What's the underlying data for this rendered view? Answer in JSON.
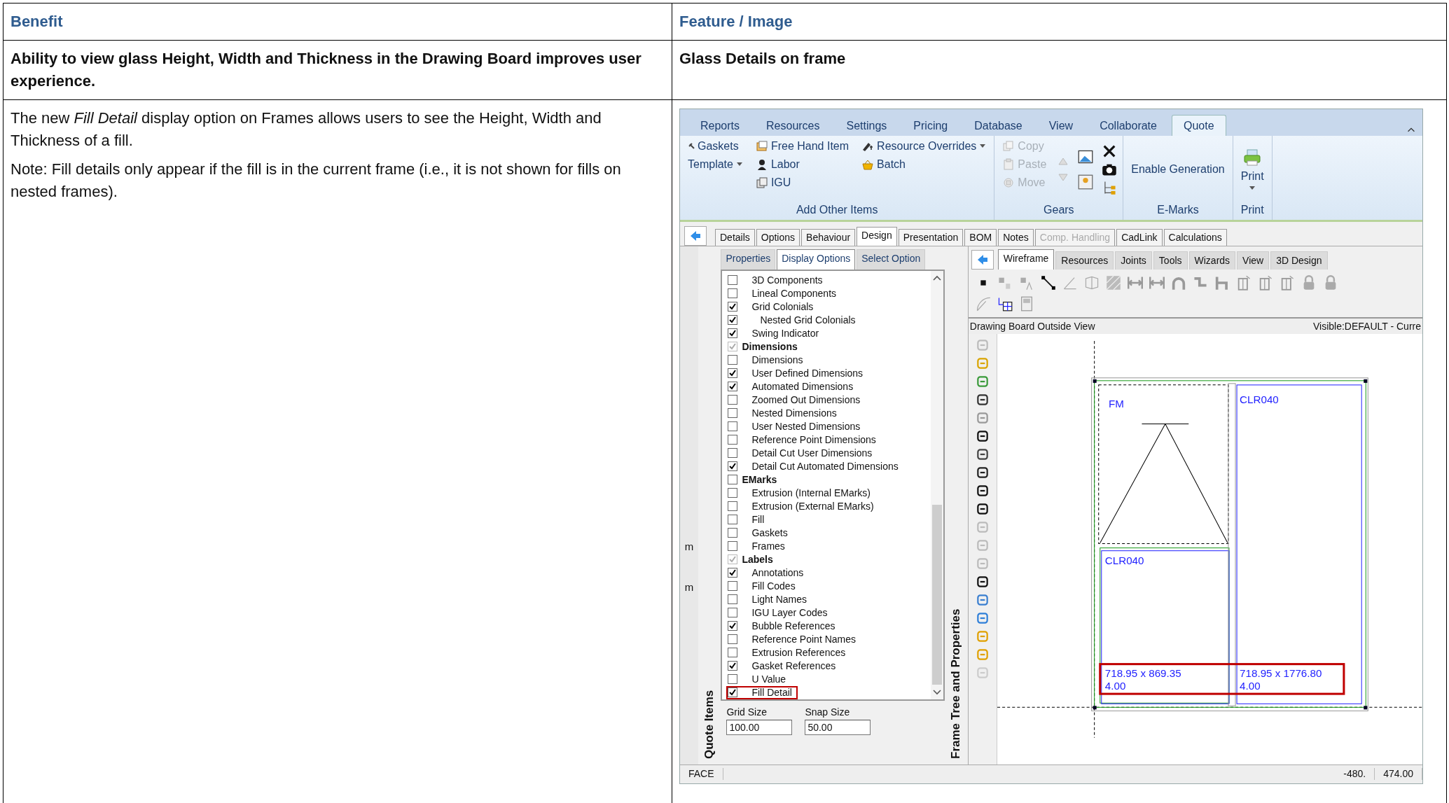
{
  "table": {
    "headers": [
      "Benefit",
      "Feature / Image"
    ],
    "summary": [
      "Ability to view glass Height, Width and Thickness in the Drawing Board improves user experience.",
      "Glass Details on frame"
    ],
    "description": [
      "The new *Fill Detail* display option on Frames allows users to see the Height, Width and Thickness of a fill.",
      "Note: Fill details only appear if the fill is in the current frame (i.e., it is not shown for fills on nested frames)."
    ],
    "screenshot": {
      "ribbon_tabs": [
        {
          "label": "Reports",
          "selected": false
        },
        {
          "label": "Resources",
          "selected": false
        },
        {
          "label": "Settings",
          "selected": false
        },
        {
          "label": "Pricing",
          "selected": false
        },
        {
          "label": "Database",
          "selected": false
        },
        {
          "label": "View",
          "selected": false
        },
        {
          "label": "Collaborate",
          "selected": false
        },
        {
          "label": "Quote",
          "selected": true
        }
      ],
      "ribbon_groups": [
        {
          "label": "Add Other Items",
          "columns": [
            [
              {
                "label": "Gaskets",
                "dropdown": false
              },
              {
                "label": "Template",
                "dropdown": true
              }
            ],
            [
              {
                "label": "Free Hand Item",
                "dropdown": false
              },
              {
                "label": "Labor",
                "dropdown": false
              },
              {
                "label": "IGU",
                "dropdown": false
              }
            ],
            [
              {
                "label": "Resource Overrides",
                "dropdown": true
              },
              {
                "label": "Batch",
                "dropdown": false
              }
            ]
          ]
        },
        {
          "label": "Gears",
          "columns": [
            [
              {
                "label": "Copy",
                "disabled": true
              },
              {
                "label": "Paste",
                "disabled": true
              },
              {
                "label": "Move",
                "disabled": true
              }
            ]
          ]
        },
        {
          "label": "E-Marks",
          "columns": [
            [
              {
                "label": "Enable Generation",
                "disabled": false
              }
            ]
          ]
        },
        {
          "label": "Print",
          "columns": [
            [
              {
                "label": "Print",
                "dropdown": true
              }
            ]
          ]
        }
      ],
      "doc_tabs": [
        {
          "label": "Details",
          "selected": false,
          "disabled": false
        },
        {
          "label": "Options",
          "selected": false,
          "disabled": false
        },
        {
          "label": "Behaviour",
          "selected": false,
          "disabled": false
        },
        {
          "label": "Design",
          "selected": true,
          "disabled": false
        },
        {
          "label": "Presentation",
          "selected": false,
          "disabled": false
        },
        {
          "label": "BOM",
          "selected": false,
          "disabled": false
        },
        {
          "label": "Notes",
          "selected": false,
          "disabled": false
        },
        {
          "label": "Comp. Handling",
          "selected": false,
          "disabled": true
        },
        {
          "label": "CadLink",
          "selected": false,
          "disabled": false
        },
        {
          "label": "Calculations",
          "selected": false,
          "disabled": false
        }
      ],
      "side_labels": [
        "m",
        "m"
      ],
      "left_title": "Quote Items",
      "panel_tabs": [
        {
          "label": "Properties",
          "selected": false
        },
        {
          "label": "Display Options",
          "selected": true
        },
        {
          "label": "Select Option",
          "selected": false
        }
      ],
      "options": [
        {
          "label": "3D Components",
          "kind": "item",
          "checked": false,
          "disabled": false,
          "highlighted": false
        },
        {
          "label": "Lineal Components",
          "kind": "item",
          "checked": false,
          "disabled": false,
          "highlighted": false
        },
        {
          "label": "Grid Colonials",
          "kind": "item",
          "checked": true,
          "disabled": false,
          "highlighted": false
        },
        {
          "label": "Nested Grid Colonials",
          "kind": "subitem",
          "checked": true,
          "disabled": false,
          "highlighted": false
        },
        {
          "label": "Swing Indicator",
          "kind": "item",
          "checked": true,
          "disabled": false,
          "highlighted": false
        },
        {
          "label": "Dimensions",
          "kind": "heading",
          "checked": true,
          "disabled": true,
          "highlighted": false
        },
        {
          "label": "Dimensions",
          "kind": "item",
          "checked": false,
          "disabled": false,
          "highlighted": false
        },
        {
          "label": "User Defined Dimensions",
          "kind": "item",
          "checked": true,
          "disabled": false,
          "highlighted": false
        },
        {
          "label": "Automated Dimensions",
          "kind": "item",
          "checked": true,
          "disabled": false,
          "highlighted": false
        },
        {
          "label": "Zoomed Out Dimensions",
          "kind": "item",
          "checked": false,
          "disabled": false,
          "highlighted": false
        },
        {
          "label": "Nested Dimensions",
          "kind": "item",
          "checked": false,
          "disabled": false,
          "highlighted": false
        },
        {
          "label": "User Nested Dimensions",
          "kind": "item",
          "checked": false,
          "disabled": false,
          "highlighted": false
        },
        {
          "label": "Reference Point Dimensions",
          "kind": "item",
          "checked": false,
          "disabled": false,
          "highlighted": false
        },
        {
          "label": "Detail Cut User Dimensions",
          "kind": "item",
          "checked": false,
          "disabled": false,
          "highlighted": false
        },
        {
          "label": "Detail Cut Automated Dimensions",
          "kind": "item",
          "checked": true,
          "disabled": false,
          "highlighted": false
        },
        {
          "label": "EMarks",
          "kind": "heading",
          "checked": false,
          "disabled": false,
          "highlighted": false
        },
        {
          "label": "Extrusion (Internal EMarks)",
          "kind": "item",
          "checked": false,
          "disabled": false,
          "highlighted": false
        },
        {
          "label": "Extrusion (External EMarks)",
          "kind": "item",
          "checked": false,
          "disabled": false,
          "highlighted": false
        },
        {
          "label": "Fill",
          "kind": "item",
          "checked": false,
          "disabled": false,
          "highlighted": false
        },
        {
          "label": "Gaskets",
          "kind": "item",
          "checked": false,
          "disabled": false,
          "highlighted": false
        },
        {
          "label": "Frames",
          "kind": "item",
          "checked": false,
          "disabled": false,
          "highlighted": false
        },
        {
          "label": "Labels",
          "kind": "heading",
          "checked": true,
          "disabled": true,
          "highlighted": false
        },
        {
          "label": "Annotations",
          "kind": "item",
          "checked": true,
          "disabled": false,
          "highlighted": false
        },
        {
          "label": "Fill Codes",
          "kind": "item",
          "checked": false,
          "disabled": false,
          "highlighted": false
        },
        {
          "label": "Light Names",
          "kind": "item",
          "checked": false,
          "disabled": false,
          "highlighted": false
        },
        {
          "label": "IGU Layer Codes",
          "kind": "item",
          "checked": false,
          "disabled": false,
          "highlighted": false
        },
        {
          "label": "Bubble References",
          "kind": "item",
          "checked": true,
          "disabled": false,
          "highlighted": false
        },
        {
          "label": "Reference Point Names",
          "kind": "item",
          "checked": false,
          "disabled": false,
          "highlighted": false
        },
        {
          "label": "Extrusion References",
          "kind": "item",
          "checked": false,
          "disabled": false,
          "highlighted": false
        },
        {
          "label": "Gasket References",
          "kind": "item",
          "checked": true,
          "disabled": false,
          "highlighted": false
        },
        {
          "label": "U Value",
          "kind": "item",
          "checked": false,
          "disabled": false,
          "highlighted": false
        },
        {
          "label": "Fill Detail",
          "kind": "item",
          "checked": true,
          "disabled": false,
          "highlighted": true
        }
      ],
      "size_fields": [
        {
          "label": "Grid Size",
          "value": "100.00"
        },
        {
          "label": "Snap Size",
          "value": "50.00"
        }
      ],
      "middle_title": "Frame Tree and Properties",
      "view_tabs": [
        {
          "label": "Wireframe",
          "selected": true
        },
        {
          "label": "Resources",
          "selected": false
        },
        {
          "label": "Joints",
          "selected": false
        },
        {
          "label": "Tools",
          "selected": false
        },
        {
          "label": "Wizards",
          "selected": false
        },
        {
          "label": "View",
          "selected": false
        },
        {
          "label": "3D Design",
          "selected": false
        }
      ],
      "view_title": "Drawing Board Outside View",
      "view_status": "Visible:DEFAULT - Curre",
      "drawing": {
        "frame_label": "FM",
        "panes": [
          {
            "label": "CLR040",
            "detail": [
              "718.95 x 869.35",
              "4.00"
            ]
          },
          {
            "label": "CLR040",
            "detail": [
              "718.95 x 1776.80",
              "4.00"
            ]
          }
        ],
        "details_highlighted": true
      },
      "status_bar": [
        "FACE",
        "-480.",
        "474.00"
      ]
    }
  }
}
